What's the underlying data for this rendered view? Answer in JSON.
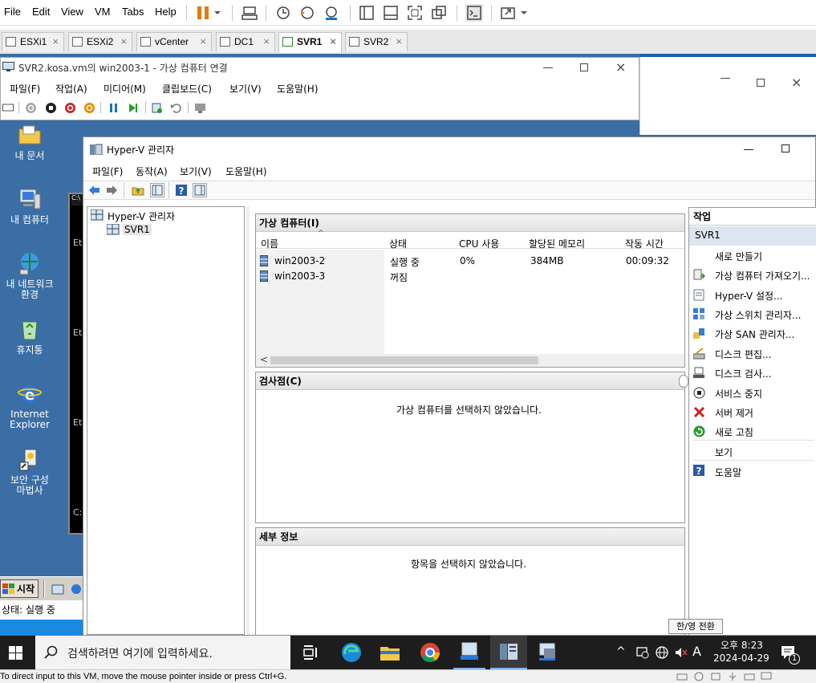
{
  "vmware": {
    "menu": [
      "File",
      "Edit",
      "View",
      "VM",
      "Tabs",
      "Help"
    ],
    "tabs": [
      {
        "label": "ESXi1"
      },
      {
        "label": "ESXi2"
      },
      {
        "label": "vCenter"
      },
      {
        "label": "DC1"
      },
      {
        "label": "SVR1",
        "active": true
      },
      {
        "label": "SVR2"
      }
    ],
    "status_text": "To direct input to this VM, move the mouse pointer inside or press Ctrl+G."
  },
  "vm_connection": {
    "title": "SVR2.kosa.vm의 win2003-1 - 가상 컴퓨터 연결",
    "menu": [
      "파일(F)",
      "작업(A)",
      "미디어(M)",
      "클립보드(C)",
      "보기(V)",
      "도움말(H)"
    ]
  },
  "guest_desktop": {
    "icons": [
      {
        "label1": "내 문서",
        "label2": ""
      },
      {
        "label1": "내 컴퓨터",
        "label2": ""
      },
      {
        "label1": "내 네트워크",
        "label2": "환경"
      },
      {
        "label1": "휴지통",
        "label2": ""
      },
      {
        "label1": "Internet",
        "label2": "Explorer"
      },
      {
        "label1": "보안 구성",
        "label2": "마법사"
      }
    ],
    "start_label": "시작",
    "status_label": "상태: 실행 중",
    "console_lines": [
      "C:\\",
      "Et",
      "Et",
      "Et",
      "C:"
    ]
  },
  "hyperv": {
    "title": "Hyper-V 관리자",
    "menu": [
      "파일(F)",
      "동작(A)",
      "보기(V)",
      "도움말(H)"
    ],
    "tree": {
      "root": "Hyper-V 관리자",
      "child": "SVR1"
    },
    "vm_pane": {
      "title": "가상 컴퓨터(I)",
      "columns": [
        "이름",
        "상태",
        "CPU 사용",
        "할당된 메모리",
        "작동 시간"
      ],
      "rows": [
        {
          "name": "win2003-2",
          "state": "실행 중",
          "cpu": "0%",
          "memory": "384MB",
          "uptime": "00:09:32"
        },
        {
          "name": "win2003-3",
          "state": "꺼짐",
          "cpu": "",
          "memory": "",
          "uptime": ""
        }
      ]
    },
    "checkpoint_pane": {
      "title": "검사점(C)",
      "message": "가상 컴퓨터를 선택하지 않았습니다."
    },
    "details_pane": {
      "title": "세부 정보",
      "message": "항목을 선택하지 않았습니다."
    },
    "actions": {
      "title": "작업",
      "group": "SVR1",
      "items": [
        "새로 만들기",
        "가상 컴퓨터 가져오기...",
        "Hyper-V 설정...",
        "가상 스위치 관리자...",
        "가상 SAN 관리자...",
        "디스크 편집...",
        "디스크 검사...",
        "서비스 중지",
        "서버 제거",
        "새로 고침",
        "보기",
        "도움말"
      ]
    }
  },
  "taskbar": {
    "search_placeholder": "검색하려면 여기에 입력하세요.",
    "ime_tooltip": "한/영 전환",
    "ime_label": "A",
    "time": "오후 8:23",
    "date": "2024-04-29",
    "notification_count": "1"
  }
}
